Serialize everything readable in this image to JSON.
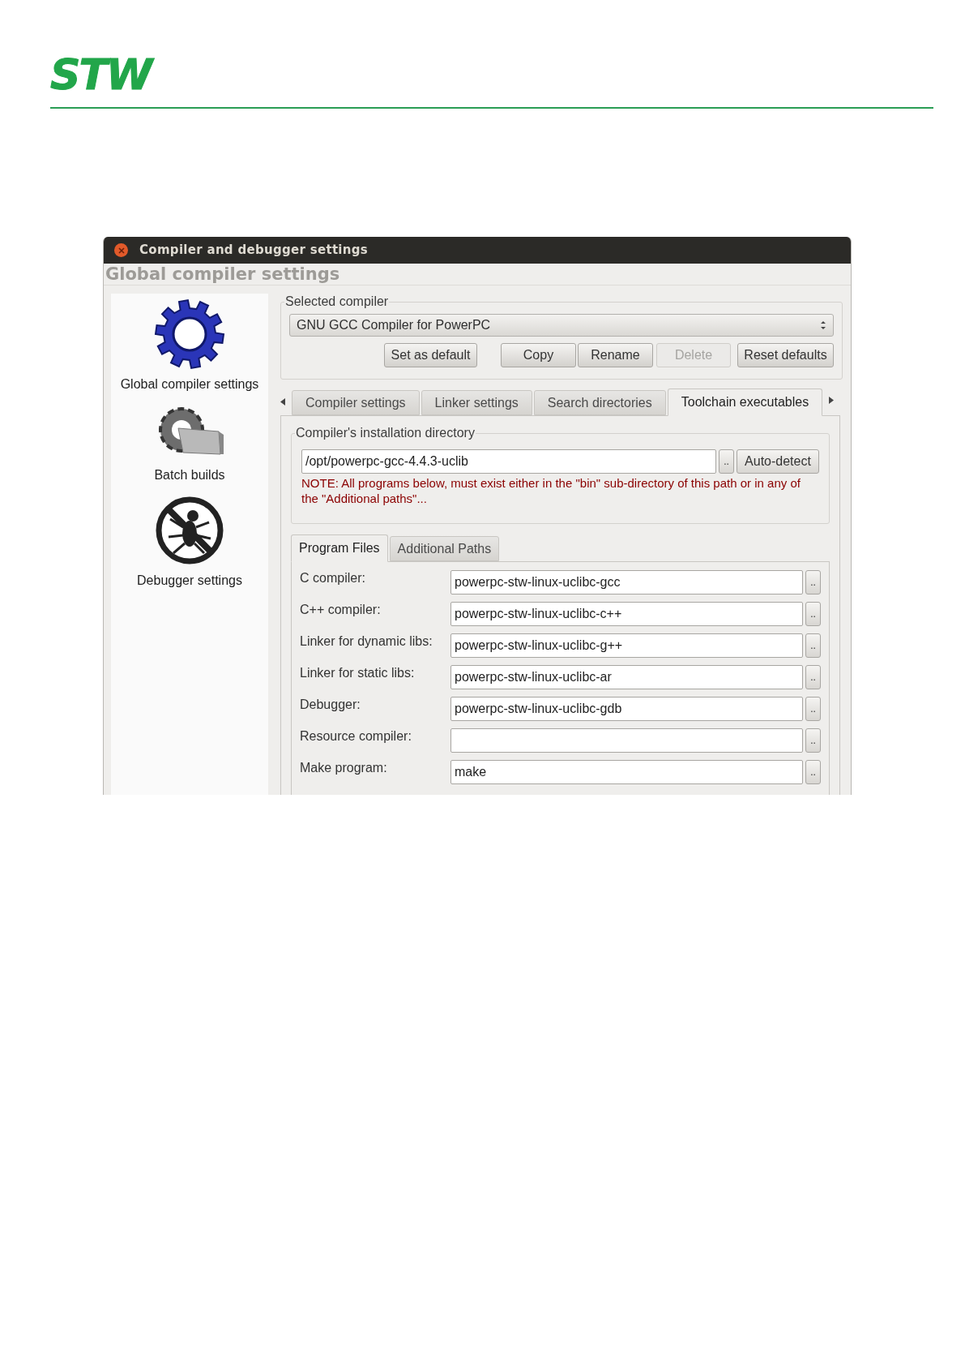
{
  "logo": {
    "text": "STW"
  },
  "window": {
    "title": "Compiler and debugger settings",
    "header": "Global compiler settings"
  },
  "sidebar": {
    "items": [
      {
        "label": "Global compiler settings",
        "kind": "gear"
      },
      {
        "label": "Batch builds",
        "kind": "batch"
      },
      {
        "label": "Debugger settings",
        "kind": "debugger"
      }
    ]
  },
  "selected_compiler": {
    "legend": "Selected compiler",
    "value": "GNU GCC Compiler for PowerPC",
    "buttons": [
      {
        "label": "Set as default",
        "disabled": false
      },
      {
        "label": "Copy",
        "disabled": false
      },
      {
        "label": "Rename",
        "disabled": false
      },
      {
        "label": "Delete",
        "disabled": true
      },
      {
        "label": "Reset defaults",
        "disabled": false
      }
    ]
  },
  "tabs": [
    {
      "label": "Compiler settings",
      "selected": false
    },
    {
      "label": "Linker settings",
      "selected": false
    },
    {
      "label": "Search directories",
      "selected": false
    },
    {
      "label": "Toolchain executables",
      "selected": true
    }
  ],
  "installation": {
    "legend": "Compiler's installation directory",
    "value": "/opt/powerpc-gcc-4.4.3-uclib",
    "browse": "..",
    "auto_detect": "Auto-detect",
    "note": "NOTE: All programs below, must exist either in the \"bin\" sub-directory of this path or in any of the \"Additional paths\"..."
  },
  "subtabs": [
    {
      "label": "Program Files",
      "selected": true
    },
    {
      "label": "Additional Paths",
      "selected": false
    }
  ],
  "programs": [
    {
      "label": "C compiler:",
      "value": "powerpc-stw-linux-uclibc-gcc",
      "browse": ".."
    },
    {
      "label": "C++ compiler:",
      "value": "powerpc-stw-linux-uclibc-c++",
      "browse": ".."
    },
    {
      "label": "Linker for dynamic libs:",
      "value": "powerpc-stw-linux-uclibc-g++",
      "browse": ".."
    },
    {
      "label": "Linker for static libs:",
      "value": "powerpc-stw-linux-uclibc-ar",
      "browse": ".."
    },
    {
      "label": "Debugger:",
      "value": "powerpc-stw-linux-uclibc-gdb",
      "browse": ".."
    },
    {
      "label": "Resource compiler:",
      "browse": ".."
    },
    {
      "label": "Make program:",
      "value": "make",
      "browse": ".."
    }
  ]
}
